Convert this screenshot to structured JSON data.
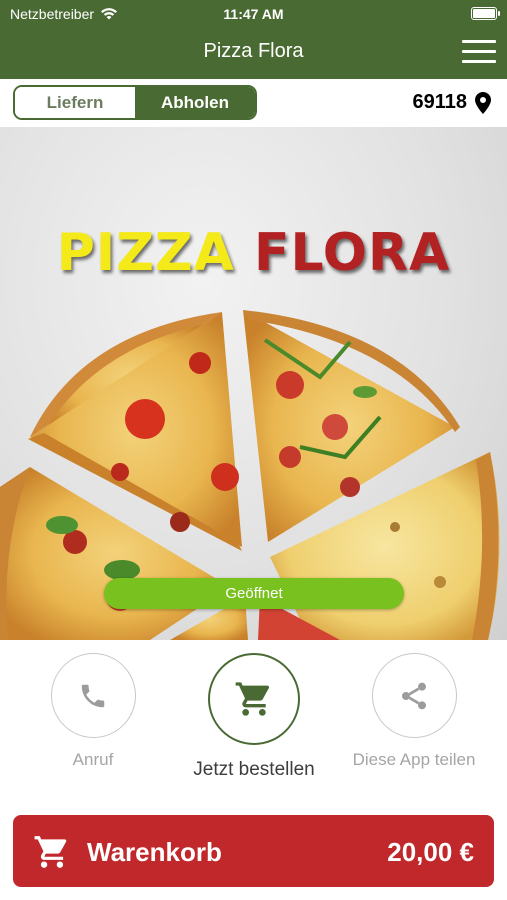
{
  "status_bar": {
    "carrier": "Netzbetreiber",
    "time": "11:47 AM"
  },
  "header": {
    "title": "Pizza Flora"
  },
  "order_mode": {
    "options": [
      "Liefern",
      "Abholen"
    ],
    "selected": "Abholen"
  },
  "location": {
    "postal_code": "69118"
  },
  "hero": {
    "logo_word_1": "PIZZA",
    "logo_word_2": "FLORA",
    "status": "Geöffnet"
  },
  "actions": [
    {
      "label": "Anruf",
      "icon": "phone-icon"
    },
    {
      "label": "Jetzt bestellen",
      "icon": "cart-icon"
    },
    {
      "label": "Diese App teilen",
      "icon": "share-icon"
    }
  ],
  "cart": {
    "label": "Warenkorb",
    "total": "20,00 €"
  },
  "colors": {
    "brand_green": "#4a6a33",
    "open_green": "#79c11e",
    "cart_red": "#c0282b"
  }
}
